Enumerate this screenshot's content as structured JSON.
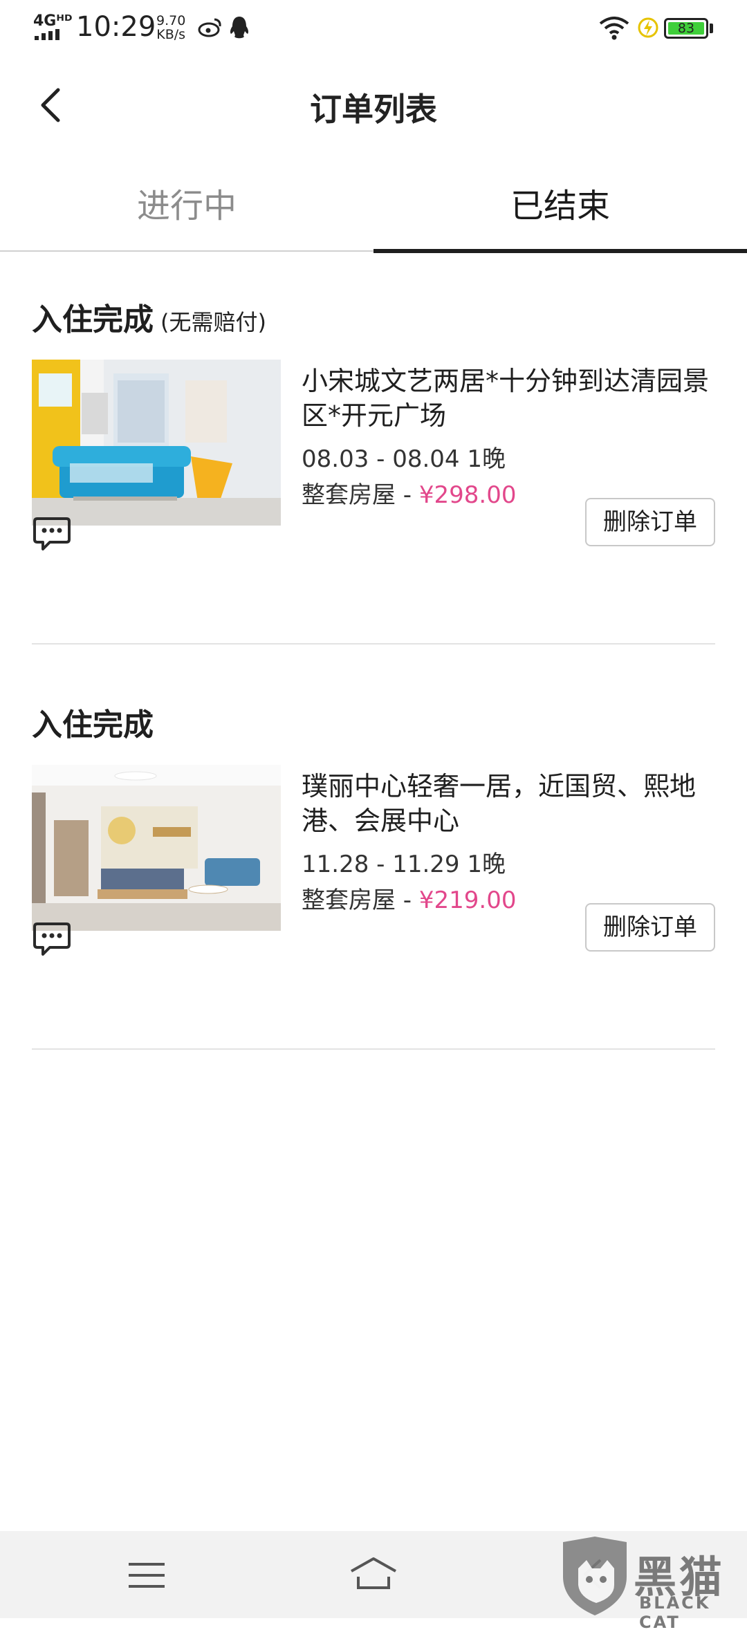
{
  "status_bar": {
    "network": "4Gᴴᴰ",
    "time": "10:29",
    "speed_value": "9.70",
    "speed_unit": "KB/s",
    "battery": "83"
  },
  "header": {
    "title": "订单列表"
  },
  "tabs": [
    {
      "label": "进行中",
      "active": false
    },
    {
      "label": "已结束",
      "active": true
    }
  ],
  "orders": [
    {
      "status": "入住完成",
      "status_note": "(无需赔付)",
      "name": "小宋城文艺两居*十分钟到达清园景区*开元广场",
      "dates": "08.03 - 08.04 1晚",
      "room_type": "整套房屋 - ",
      "price": "¥298.00",
      "delete_label": "删除订单"
    },
    {
      "status": "入住完成",
      "status_note": "",
      "name": "璞丽中心轻奢一居，近国贸、熙地港、会展中心",
      "dates": "11.28 - 11.29 1晚",
      "room_type": "整套房屋 - ",
      "price": "¥219.00",
      "delete_label": "删除订单"
    }
  ],
  "watermark": {
    "text": "黑猫",
    "sub": "BLACK CAT"
  },
  "colors": {
    "price": "#e2478b",
    "tab_indicator": "#1e1e1e",
    "battery": "#3fcf3a"
  }
}
